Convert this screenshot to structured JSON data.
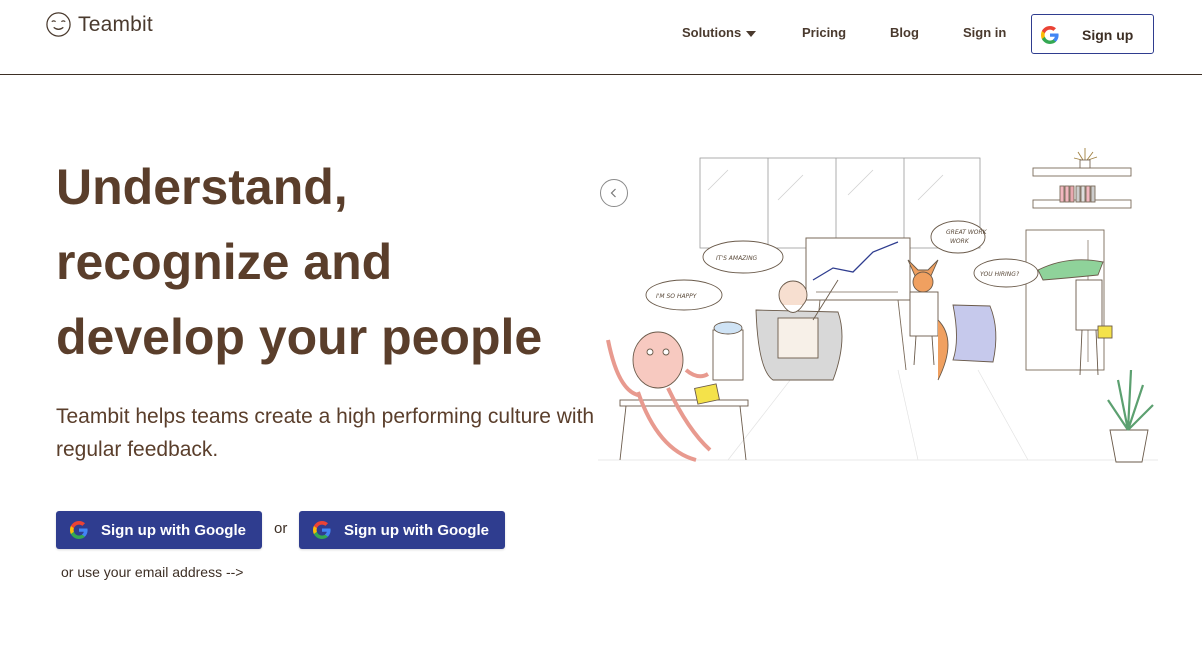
{
  "brand": {
    "name": "Teambit"
  },
  "nav": {
    "solutions": "Solutions",
    "pricing": "Pricing",
    "blog": "Blog",
    "signin": "Sign in",
    "signup": "Sign up"
  },
  "hero": {
    "title_lines": [
      "Understand,",
      "recognize and",
      "develop your people"
    ],
    "subtitle": "Teambit helps teams create a high performing culture with regular feedback.",
    "cta_primary": "Sign up with Google",
    "or": "or",
    "cta_secondary": "Sign up with Google",
    "email_link": "or use your email address -->"
  },
  "illustration": {
    "bubbles": [
      "I'M SO HAPPY",
      "IT'S AMAZING",
      "GREAT WORK",
      "YOU HIRING?"
    ]
  },
  "colors": {
    "primary_button": "#2f3d8f",
    "heading_text": "#5a3e2b",
    "header_border": "#3d2f25"
  },
  "icons": {
    "logo": "smiling-face-icon",
    "google": "google-g-icon",
    "dropdown": "caret-down-icon",
    "carousel": "chevron-left-icon"
  }
}
